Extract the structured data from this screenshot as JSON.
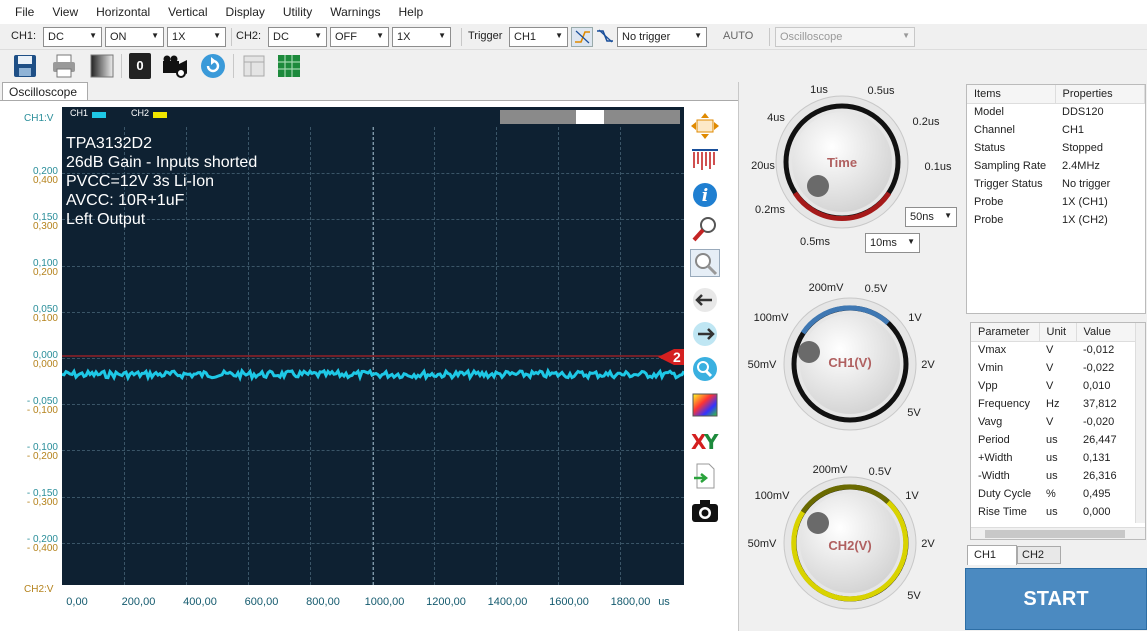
{
  "menu": [
    "File",
    "View",
    "Horizontal",
    "Vertical",
    "Display",
    "Utility",
    "Warnings",
    "Help"
  ],
  "settings": {
    "ch1_label": "CH1:",
    "ch1_coupling": "DC",
    "ch1_state": "ON",
    "ch1_probe": "1X",
    "ch2_label": "CH2:",
    "ch2_coupling": "DC",
    "ch2_state": "OFF",
    "ch2_probe": "1X",
    "trigger_label": "Trigger",
    "trigger_source": "CH1",
    "trigger_mode": "No trigger",
    "auto_label": "AUTO",
    "device": "Oscilloscope"
  },
  "toolbar": {
    "counter": "0"
  },
  "tab": "Oscilloscope",
  "scope": {
    "legend_ch1": "CH1",
    "legend_ch2": "CH2",
    "ch1_axis_label": "CH1:V",
    "ch2_axis_label": "CH2:V",
    "overlay": [
      "TPA3132D2",
      "26dB Gain - Inputs shorted",
      "PVCC=12V 3s Li-Ion",
      "AVCC: 10R+1uF",
      "Left Output"
    ],
    "y_ticks": [
      {
        "ch1": "0,200",
        "ch2": "0,400"
      },
      {
        "ch1": "0,150",
        "ch2": "0,300"
      },
      {
        "ch1": "0,100",
        "ch2": "0,200"
      },
      {
        "ch1": "0,050",
        "ch2": "0,100"
      },
      {
        "ch1": "0,000",
        "ch2": "0,000"
      },
      {
        "ch1": "- 0,050",
        "ch2": "- 0,100"
      },
      {
        "ch1": "- 0,100",
        "ch2": "- 0,200"
      },
      {
        "ch1": "- 0,150",
        "ch2": "- 0,300"
      },
      {
        "ch1": "- 0,200",
        "ch2": "- 0,400"
      }
    ],
    "x_ticks": [
      "0,00",
      "200,00",
      "400,00",
      "600,00",
      "800,00",
      "1000,00",
      "1200,00",
      "1400,00",
      "1600,00",
      "1800,00"
    ],
    "x_unit": "us",
    "trigger_marker": "2",
    "trace_level_v": -0.02,
    "colors": {
      "ch1": "#1ec8e6",
      "ch2": "#f2e600",
      "background": "#0e2132",
      "trigger": "#d42020"
    }
  },
  "time_knob": {
    "title": "Time",
    "labels": [
      "1us",
      "0.5us",
      "4us",
      "0.2us",
      "20us",
      "0.1us",
      "0.2ms",
      "0.5ms"
    ],
    "select_fine": "50ns",
    "select_coarse": "10ms"
  },
  "ch1_knob": {
    "title": "CH1(V)",
    "labels": [
      "200mV",
      "0.5V",
      "100mV",
      "1V",
      "50mV",
      "2V",
      "5V"
    ]
  },
  "ch2_knob": {
    "title": "CH2(V)",
    "labels": [
      "200mV",
      "0.5V",
      "100mV",
      "1V",
      "50mV",
      "2V",
      "5V"
    ]
  },
  "properties": {
    "headers": [
      "Items",
      "Properties"
    ],
    "rows": [
      [
        "Model",
        "DDS120"
      ],
      [
        "Channel",
        "CH1"
      ],
      [
        "Status",
        "Stopped"
      ],
      [
        "Sampling Rate",
        "2.4MHz"
      ],
      [
        "Trigger Status",
        "No trigger"
      ],
      [
        "Probe",
        "1X (CH1)"
      ],
      [
        "Probe",
        "1X (CH2)"
      ]
    ]
  },
  "parameters": {
    "headers": [
      "Parameter",
      "Unit",
      "Value"
    ],
    "rows": [
      [
        "Vmax",
        "V",
        "-0,012"
      ],
      [
        "Vmin",
        "V",
        "-0,022"
      ],
      [
        "Vpp",
        "V",
        "0,010"
      ],
      [
        "Frequency",
        "Hz",
        "37,812"
      ],
      [
        "Vavg",
        "V",
        "-0,020"
      ],
      [
        "Period",
        "us",
        "26,447"
      ],
      [
        "+Width",
        "us",
        "0,131"
      ],
      [
        "-Width",
        "us",
        "26,316"
      ],
      [
        "Duty Cycle",
        "%",
        "0,495"
      ],
      [
        "Rise Time",
        "us",
        "0,000"
      ]
    ]
  },
  "channel_tabs": [
    "CH1",
    "CH2"
  ],
  "start_label": "START"
}
